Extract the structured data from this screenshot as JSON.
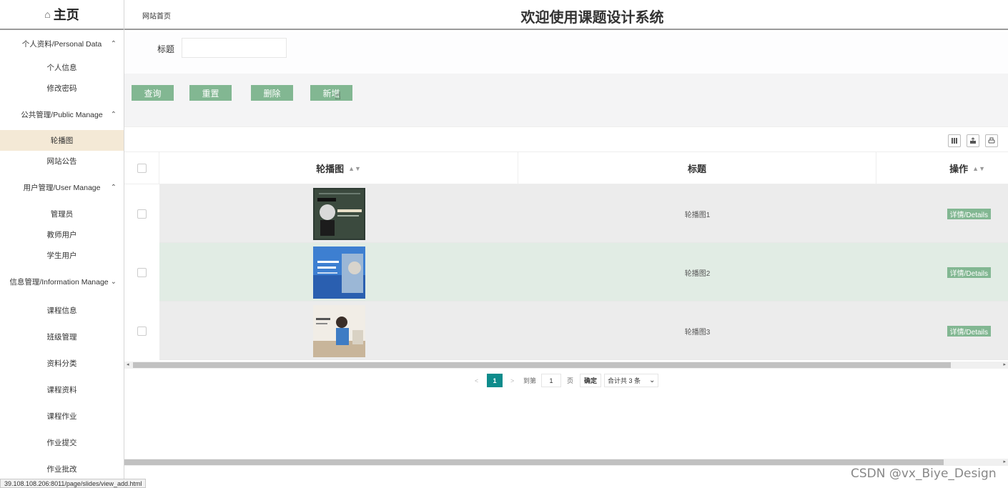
{
  "sidebar": {
    "home_title": "主页",
    "groups": [
      {
        "label": "个人资料/Personal Data",
        "chevron": "^",
        "items": [
          "个人信息",
          "修改密码"
        ]
      },
      {
        "label": "公共管理/Public Manage",
        "chevron": "^",
        "items": [
          "轮播图",
          "网站公告"
        ]
      },
      {
        "label": "用户管理/User Manage",
        "chevron": "^",
        "items": [
          "管理员",
          "教师用户",
          "学生用户"
        ]
      },
      {
        "label": "信息管理/Information Manage",
        "chevron": "v",
        "items": [
          "课程信息",
          "班级管理",
          "资料分类",
          "课程资料",
          "课程作业",
          "作业提交",
          "作业批改"
        ]
      }
    ],
    "active_item": "轮播图"
  },
  "topbar": {
    "breadcrumb": "网站首页",
    "title": "欢迎使用课题设计系统"
  },
  "search": {
    "label": "标题",
    "value": ""
  },
  "buttons": {
    "query": "查询",
    "reset": "重置",
    "delete": "删除",
    "add": "新增"
  },
  "table": {
    "columns": [
      "轮播图",
      "标题",
      "操作"
    ],
    "rows": [
      {
        "image_icon": "slide-image-1",
        "title": "轮播图1",
        "action": "详情/Details",
        "highlight": false
      },
      {
        "image_icon": "slide-image-2",
        "title": "轮播图2",
        "action": "详情/Details",
        "highlight": true
      },
      {
        "image_icon": "slide-image-3",
        "title": "轮播图3",
        "action": "详情/Details",
        "highlight": false
      }
    ]
  },
  "pagination": {
    "prev": "<",
    "current_page": "1",
    "next": ">",
    "goto_label": "到第",
    "goto_value": "1",
    "page_unit": "页",
    "confirm": "确定",
    "total": "合计共 3 条"
  },
  "status_url": "39.108.108.206:8011/page/slides/view_add.html",
  "watermark": "CSDN @vx_Biye_Design",
  "colors": {
    "button_green": "#82b792",
    "active_bg": "#f4e9d6",
    "row_highlight": "#e1ece4",
    "pager_active": "#0e8c8c"
  }
}
